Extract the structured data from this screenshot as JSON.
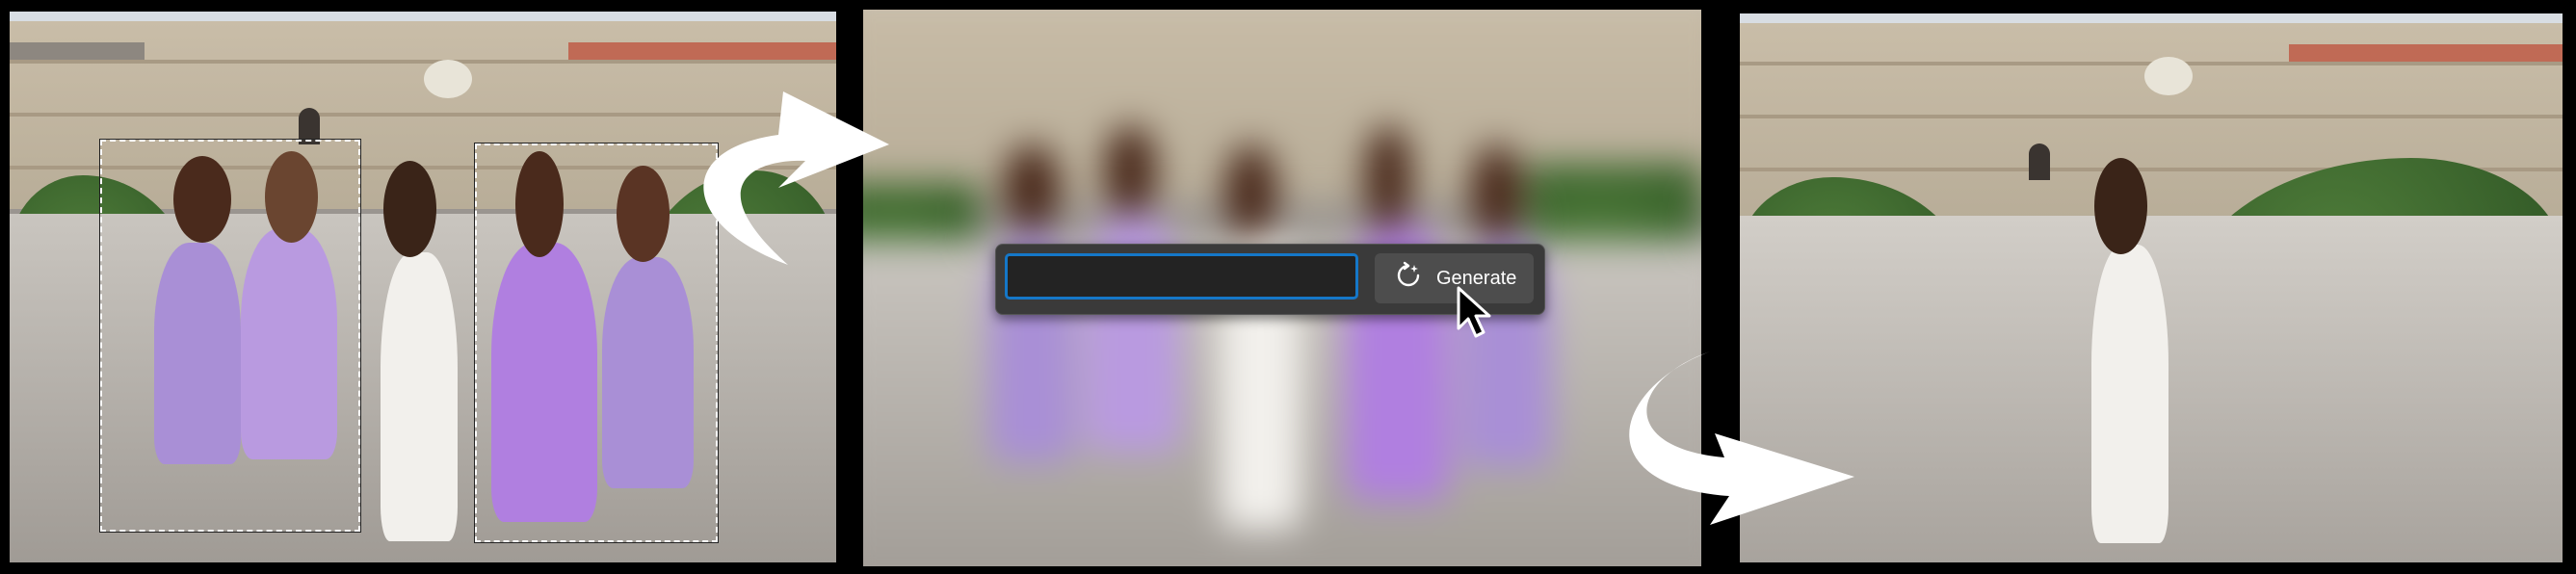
{
  "canvas": {
    "background": "#000000"
  },
  "panels": [
    {
      "id": "original",
      "caption": ""
    },
    {
      "id": "blurred-with-prompt",
      "caption": ""
    },
    {
      "id": "result",
      "caption": ""
    }
  ],
  "generative_fill_bar": {
    "prompt_value": "",
    "prompt_placeholder": "",
    "generate_label": "Generate",
    "generate_icon": "generate-sparkle-icon",
    "accent_color": "#1577c8"
  },
  "colors": {
    "dress_lavender": "#a98fd6",
    "dress_purple": "#b07fe0",
    "dress_white": "#f2f0ec",
    "hedge_green": "#3d6a2e",
    "roof_red": "#c06a55"
  },
  "icons": [
    "curved-arrow-icon",
    "mouse-cursor-icon"
  ]
}
